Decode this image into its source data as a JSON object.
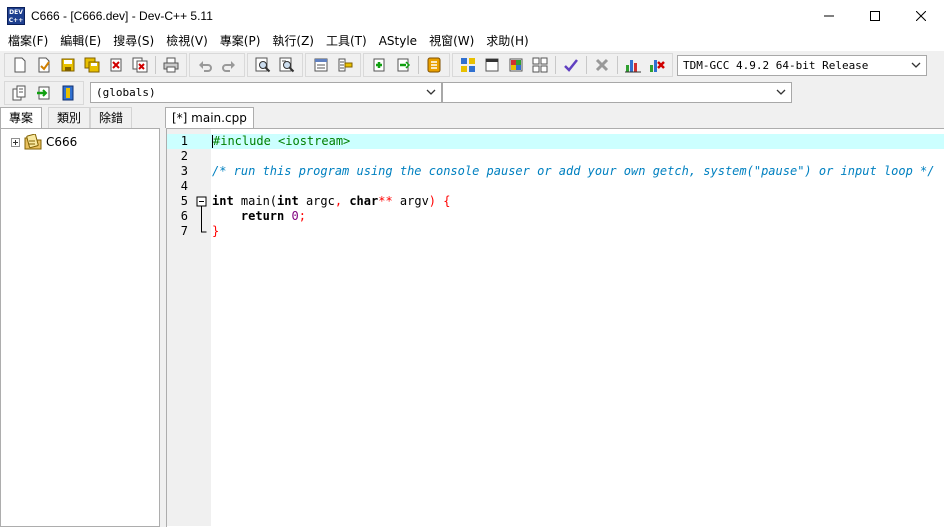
{
  "window": {
    "app_icon_label": "DEV C++",
    "title": "C666 - [C666.dev] - Dev-C++ 5.11",
    "controls": [
      "minimize-icon",
      "maximize-icon",
      "close-icon"
    ]
  },
  "menu": [
    {
      "label": "檔案(F)"
    },
    {
      "label": "編輯(E)"
    },
    {
      "label": "搜尋(S)"
    },
    {
      "label": "檢視(V)"
    },
    {
      "label": "專案(P)"
    },
    {
      "label": "執行(Z)"
    },
    {
      "label": "工具(T)"
    },
    {
      "label": "AStyle"
    },
    {
      "label": "視窗(W)"
    },
    {
      "label": "求助(H)"
    }
  ],
  "toolbar": {
    "compiler_select": "TDM-GCC 4.9.2 64-bit Release",
    "scope_select": "(globals)",
    "member_select": ""
  },
  "left_panel": {
    "tabs": [
      {
        "label": "專案",
        "active": true
      },
      {
        "label": "類別",
        "active": false
      },
      {
        "label": "除錯",
        "active": false
      }
    ],
    "tree": [
      {
        "label": "C666"
      }
    ]
  },
  "editor": {
    "tab_label": "[*] main.cpp",
    "lines": [
      {
        "num": "1"
      },
      {
        "num": "2"
      },
      {
        "num": "3"
      },
      {
        "num": "4"
      },
      {
        "num": "5"
      },
      {
        "num": "6"
      },
      {
        "num": "7"
      }
    ],
    "code": {
      "l1": "#include <iostream>",
      "l3": "/* run this program using the console pauser or add your own getch, system(\"pause\") or input loop */",
      "l5_kw1": "int",
      "l5_fn": " main(",
      "l5_kw2": "int",
      "l5_argc": " argc",
      "l5_comma": ",",
      "l5_kw3": " char",
      "l5_stars": "**",
      "l5_argv": " argv",
      "l5_close": ") {",
      "l6_indent": "    ",
      "l6_kw": "return",
      "l6_num": " 0",
      "l6_semi": ";",
      "l7": "}"
    }
  },
  "colors": {
    "current_line": "#ccffff",
    "preprocessor": "#008000",
    "comment": "#0080c0",
    "symbol": "#ff0000",
    "number": "#800080"
  }
}
